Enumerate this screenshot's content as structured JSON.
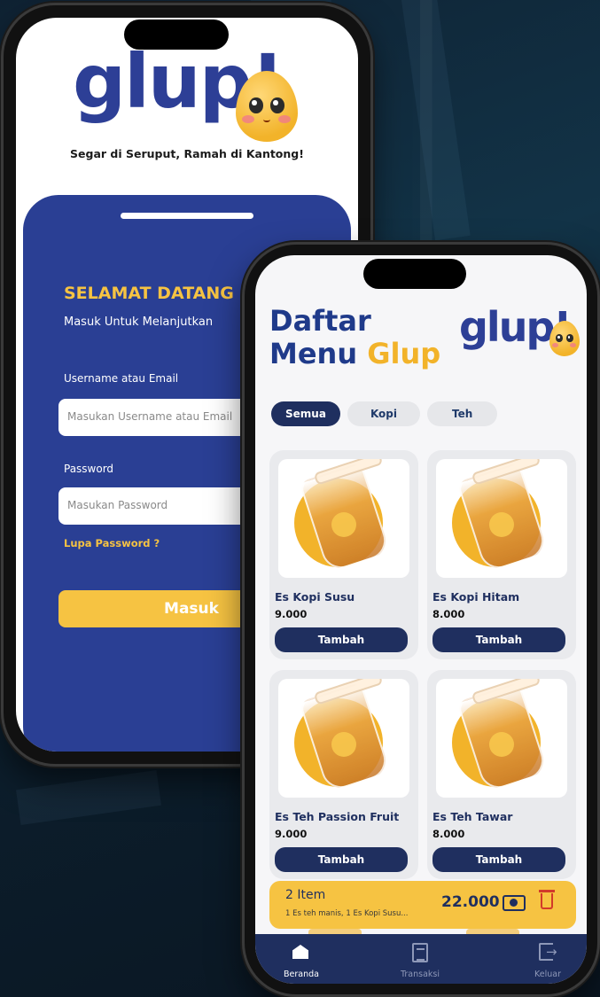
{
  "login_screen": {
    "logo": "glup!",
    "tagline": "Segar di Seruput, Ramah di Kantong!",
    "welcome": "SELAMAT DATANG",
    "subtitle": "Masuk Untuk Melanjutkan",
    "username_label": "Username atau Email",
    "username_placeholder": "Masukan Username atau Email",
    "password_label": "Password",
    "password_placeholder": "Masukan Password",
    "forgot_link": "Lupa Password ?",
    "login_button": "Masuk"
  },
  "menu_screen": {
    "title_line1": "Daftar",
    "title_line2_main": "Menu",
    "title_line2_accent": "Glup",
    "logo": "glup!",
    "chips": [
      "Semua",
      "Kopi",
      "Teh"
    ],
    "active_chip": "Semua",
    "products": [
      {
        "name": "Es Kopi Susu",
        "price": "9.000",
        "button": "Tambah"
      },
      {
        "name": "Es Kopi Hitam",
        "price": "8.000",
        "button": "Tambah"
      },
      {
        "name": "Es Teh Passion Fruit",
        "price": "9.000",
        "button": "Tambah"
      },
      {
        "name": "Es Teh Tawar",
        "price": "8.000",
        "button": "Tambah"
      }
    ],
    "cart": {
      "count": "2 Item",
      "summary": "1 Es teh manis, 1 Es Kopi Susu...",
      "total": "22.000"
    },
    "nav": [
      {
        "label": "Beranda",
        "icon": "home-icon"
      },
      {
        "label": "Transaksi",
        "icon": "list-icon"
      },
      {
        "label": "Keluar",
        "icon": "logout-icon"
      }
    ]
  },
  "colors": {
    "brand_blue": "#2a3f94",
    "navy": "#1f2f5f",
    "accent_yellow": "#f6c342",
    "danger_red": "#d23a2a"
  }
}
